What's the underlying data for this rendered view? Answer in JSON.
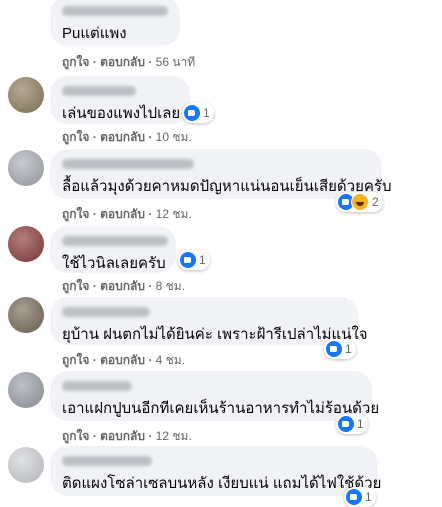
{
  "actions": {
    "like": "ถูกใจ",
    "reply": "ตอบกลับ",
    "separator": "·"
  },
  "comments": [
    {
      "text": "Puแต่แพง",
      "time": "56 นาที"
    },
    {
      "text": "เล่นของแพงไปเลย",
      "time": "10 ชม.",
      "reactions": "1",
      "reaction_icons": [
        "like-icon"
      ]
    },
    {
      "text": "ลื้อแล้วมุงด้วยคาหมดปัญหาแน่นอนเย็นเสียด้วยครับ",
      "time": "12 ชม.",
      "reactions": "2",
      "reaction_icons": [
        "like-icon",
        "haha-icon"
      ]
    },
    {
      "text": "ใช้ไวนิลเลยครับ",
      "time": "8 ชม.",
      "reactions": "1",
      "reaction_icons": [
        "like-icon"
      ]
    },
    {
      "text": "ยุบ้าน ฝนตกไม่ได้ยินค่ะ เพราะฝ้ารีเปล่าไม่แน่ใจ",
      "time": "4 ชม.",
      "reactions": "1",
      "reaction_icons": [
        "like-icon"
      ]
    },
    {
      "text": "เอาแฝกปูบนอีกทีเคยเห็นร้านอาหารทำไม่ร้อนด้วย",
      "time": "12 ชม.",
      "reactions": "1",
      "reaction_icons": [
        "like-icon"
      ]
    },
    {
      "text": "ติดแผงโซล่าเซลบนหลัง เงียบแน่ แถมได้ไฟใช้ด้วย",
      "reactions": "1",
      "reaction_icons": [
        "like-icon"
      ]
    }
  ],
  "colors": {
    "bubble": "#f0f2f5",
    "meta": "#65676b",
    "like": "#1877f2",
    "haha": "#f7b125"
  }
}
